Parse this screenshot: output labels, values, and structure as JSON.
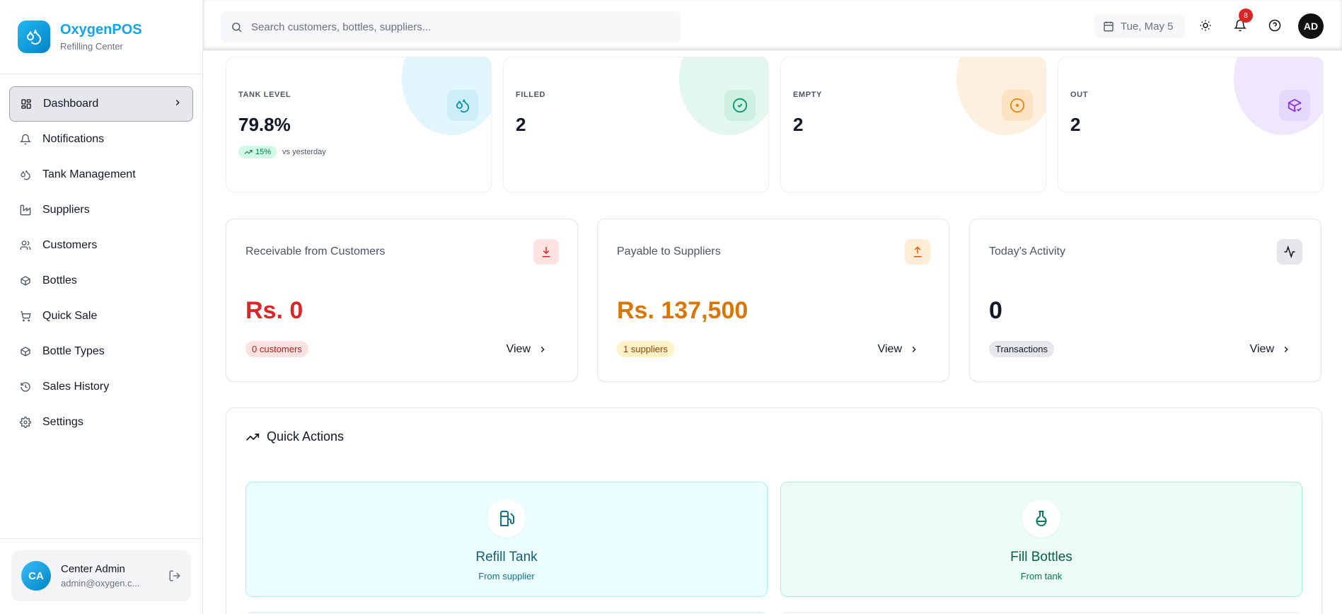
{
  "brand": {
    "name": "OxygenPOS",
    "subtitle": "Refilling Center"
  },
  "nav": {
    "items": [
      {
        "label": "Dashboard",
        "icon": "grid-icon",
        "active": true
      },
      {
        "label": "Notifications",
        "icon": "bell-icon"
      },
      {
        "label": "Tank Management",
        "icon": "droplets-icon"
      },
      {
        "label": "Suppliers",
        "icon": "factory-icon"
      },
      {
        "label": "Customers",
        "icon": "users-icon"
      },
      {
        "label": "Bottles",
        "icon": "package-icon"
      },
      {
        "label": "Quick Sale",
        "icon": "cart-icon"
      },
      {
        "label": "Bottle Types",
        "icon": "package-icon"
      },
      {
        "label": "Sales History",
        "icon": "history-icon"
      },
      {
        "label": "Settings",
        "icon": "gear-icon"
      }
    ]
  },
  "user": {
    "initials": "CA",
    "name": "Center Admin",
    "email": "admin@oxygen.c..."
  },
  "topbar": {
    "search_placeholder": "Search customers, bottles, suppliers...",
    "date": "Tue, May 5",
    "notification_count": "8",
    "avatar_initials": "AD"
  },
  "stats": [
    {
      "label": "TANK LEVEL",
      "value": "79.8%",
      "trend": "15%",
      "trend_note": "vs yesterday",
      "color": "#0ea5e9",
      "bg": "#e0f2fe",
      "icon": "droplets-icon"
    },
    {
      "label": "FILLED",
      "value": "2",
      "color": "#059669",
      "bg": "#d1fae5",
      "icon": "check-circle-icon"
    },
    {
      "label": "EMPTY",
      "value": "2",
      "color": "#f59e0b",
      "bg": "#fef3c7",
      "icon": "circle-dot-icon"
    },
    {
      "label": "OUT",
      "value": "2",
      "color": "#9333ea",
      "bg": "#ede9fe",
      "icon": "package-check-icon"
    }
  ],
  "finance": [
    {
      "title": "Receivable from Customers",
      "value": "Rs. 0",
      "pill": "0 customers",
      "view": "View",
      "color": "#dc2626"
    },
    {
      "title": "Payable to Suppliers",
      "value": "Rs. 137,500",
      "pill": "1 suppliers",
      "view": "View",
      "color": "#d97706"
    },
    {
      "title": "Today's Activity",
      "value": "0",
      "pill": "Transactions",
      "view": "View",
      "color": "#111827"
    }
  ],
  "quick_actions": {
    "title": "Quick Actions",
    "items": [
      {
        "title": "Refill Tank",
        "subtitle": "From supplier",
        "icon": "fuel-icon",
        "color": "#0e7490",
        "bg": "#ecfeff"
      },
      {
        "title": "Fill Bottles",
        "subtitle": "From tank",
        "icon": "flask-icon",
        "color": "#047857",
        "bg": "#ecfdf5"
      }
    ]
  }
}
